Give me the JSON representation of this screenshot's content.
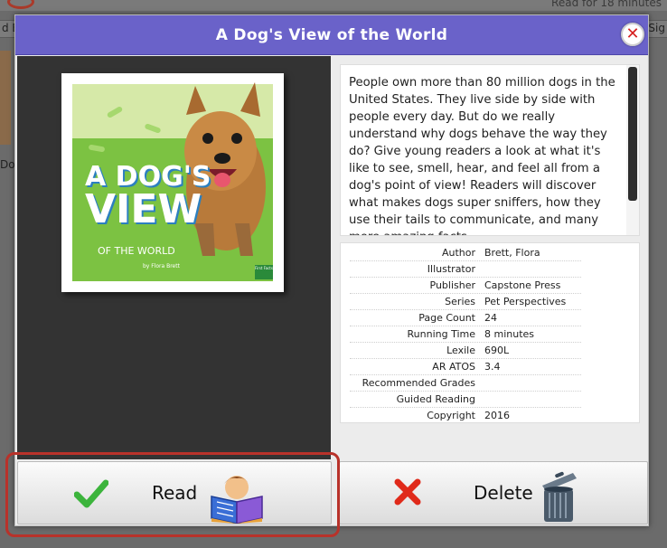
{
  "background": {
    "top_text": "Read for 18 minutes",
    "tab_left_text": "d B",
    "tab_right_text": "Sig",
    "label_text": "Do"
  },
  "modal": {
    "title": "A Dog's View of the World",
    "close_symbol": "✕",
    "description": "People own more than 80 million dogs in the United States. They live side by side with people every day. But do we really understand why dogs behave the way they do? Give young readers a look at what it's like to see, smell, hear, and feel all from a dog's point of view! Readers will discover what makes dogs super sniffers, how they use their tails to communicate, and many more amazing facts.",
    "cover": {
      "title_line1": "A DOG'S",
      "title_line2": "VIEW",
      "subtitle": "OF THE WORLD",
      "author": "by Flora Brett",
      "badge": "First Facts"
    },
    "metadata": [
      {
        "key": "Author",
        "value": "Brett, Flora"
      },
      {
        "key": "Illustrator",
        "value": ""
      },
      {
        "key": "Publisher",
        "value": "Capstone Press"
      },
      {
        "key": "Series",
        "value": "Pet Perspectives"
      },
      {
        "key": "Page Count",
        "value": "24"
      },
      {
        "key": "Running Time",
        "value": "8 minutes"
      },
      {
        "key": "Lexile",
        "value": "690L"
      },
      {
        "key": "AR ATOS",
        "value": "3.4"
      },
      {
        "key": "Recommended Grades",
        "value": ""
      },
      {
        "key": "Guided Reading",
        "value": ""
      },
      {
        "key": "Copyright",
        "value": "2016"
      }
    ],
    "buttons": {
      "read_label": "Read",
      "delete_label": "Delete"
    }
  },
  "colors": {
    "header": "#6a62c9",
    "highlight": "#b8322a",
    "check": "#3cb43c",
    "delete_x": "#e02a1a"
  },
  "icons": {
    "close": "close-icon",
    "read": "checkmark-icon",
    "reader": "child-reading-icon",
    "delete": "x-icon",
    "trash": "trash-can-icon"
  }
}
